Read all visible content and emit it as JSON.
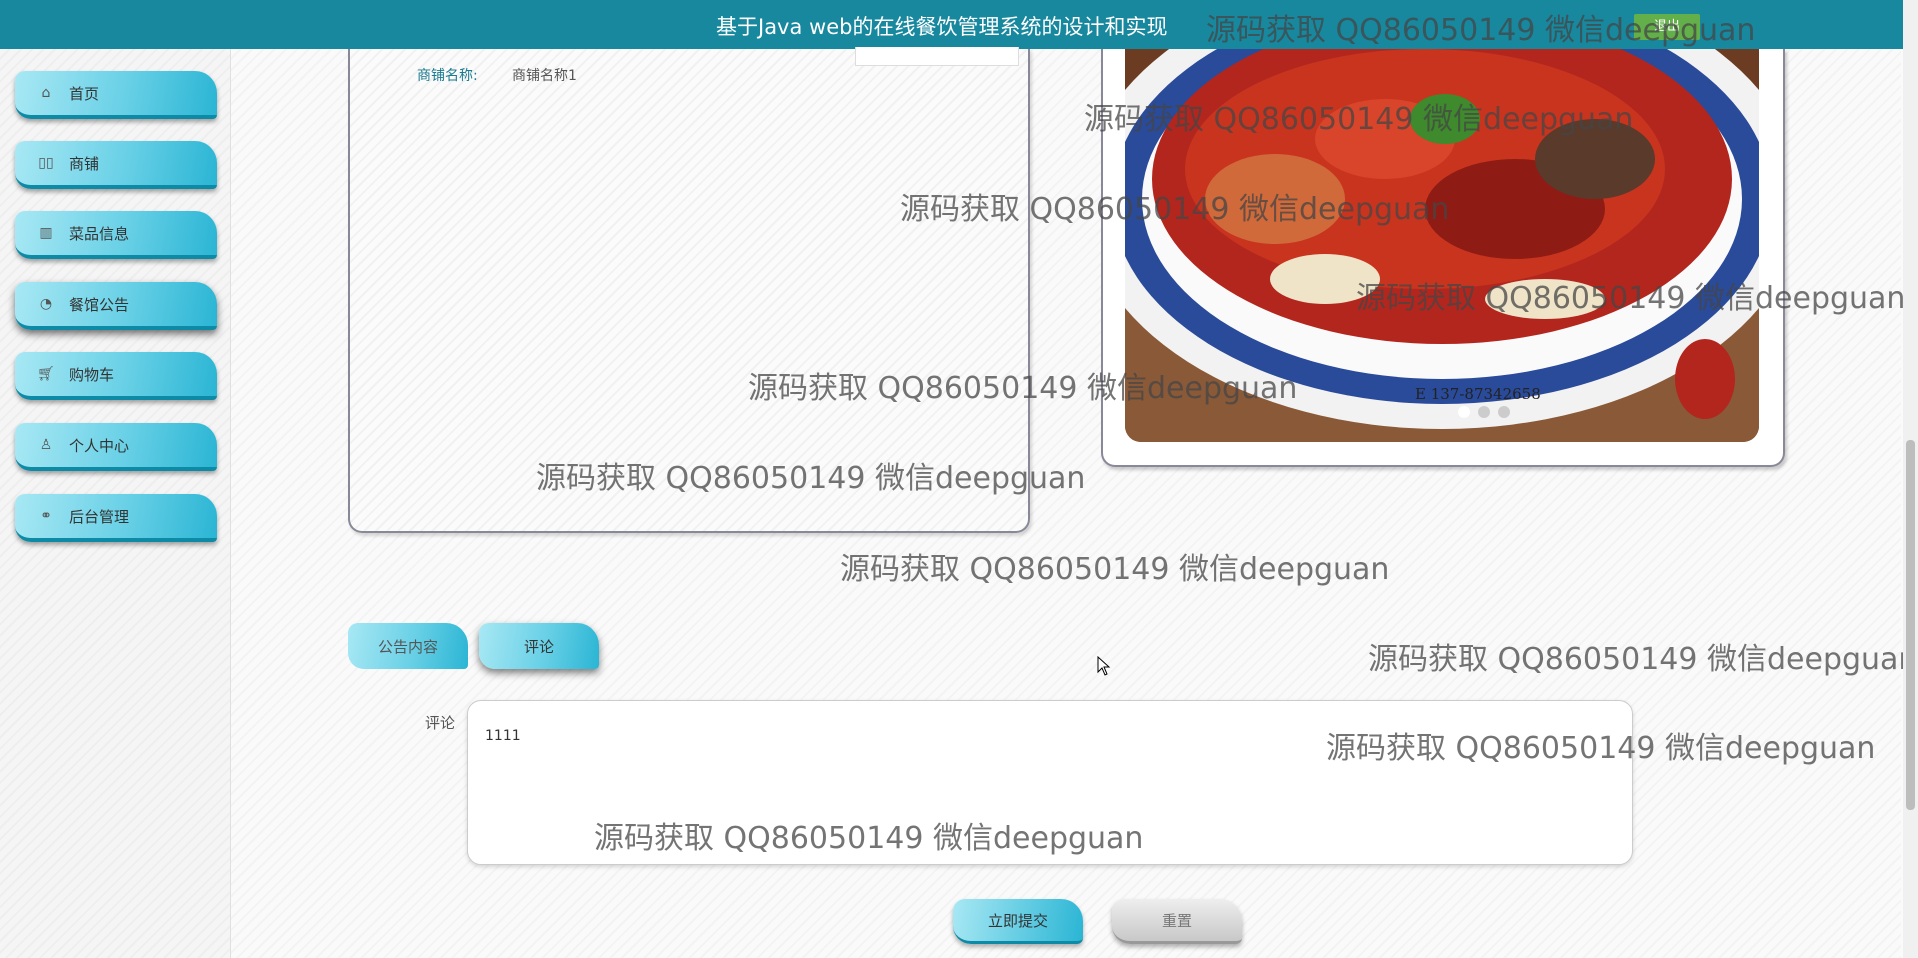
{
  "header": {
    "title": "基于Java web的在线餐饮管理系统的设计和实现",
    "logout_label": "退出"
  },
  "sidebar": {
    "items": [
      {
        "label": "首页",
        "icon": "home-icon"
      },
      {
        "label": "商铺",
        "icon": "shop-icon"
      },
      {
        "label": "菜品信息",
        "icon": "dish-icon"
      },
      {
        "label": "餐馆公告",
        "icon": "palette-icon"
      },
      {
        "label": "购物车",
        "icon": "cart-icon"
      },
      {
        "label": "个人中心",
        "icon": "user-icon"
      },
      {
        "label": "后台管理",
        "icon": "link-icon"
      }
    ],
    "active_index": 3
  },
  "detail": {
    "shop_label": "商铺名称:",
    "shop_value": "商铺名称1"
  },
  "carousel": {
    "image_text": "137-87342658",
    "dot_count": 3,
    "active_dot": 0
  },
  "tabs": [
    {
      "label": "公告内容"
    },
    {
      "label": "评论"
    }
  ],
  "comment": {
    "label": "评论",
    "value": "1111"
  },
  "buttons": {
    "submit": "立即提交",
    "reset": "重置"
  },
  "watermark": "源码获取 QQ86050149 微信deepguan",
  "colors": {
    "header_bg": "#17889e",
    "accent": "#2ab5d4",
    "logout_bg": "#63b04a"
  }
}
